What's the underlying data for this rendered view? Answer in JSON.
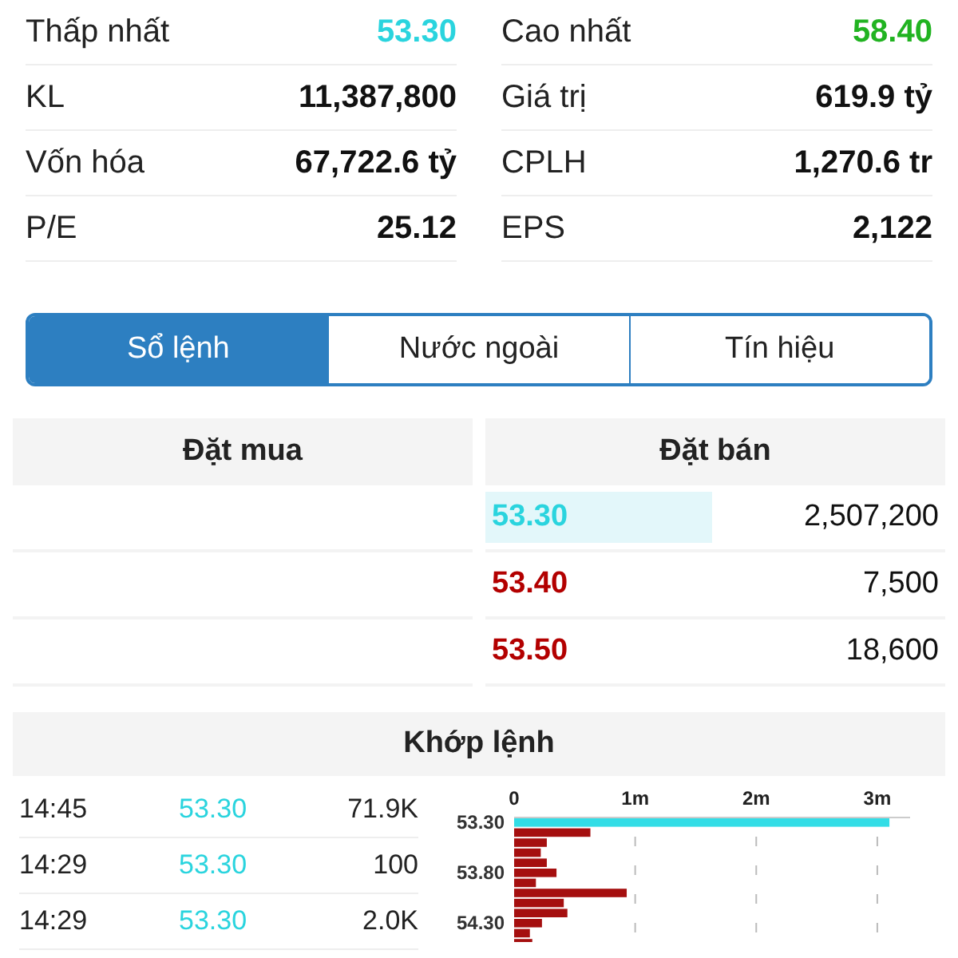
{
  "stats": [
    {
      "label": "Thấp nhất",
      "value": "53.30",
      "color": "#2ad4de"
    },
    {
      "label": "Cao nhất",
      "value": "58.40",
      "color": "#21b321"
    },
    {
      "label": "KL",
      "value": "11,387,800",
      "color": "#111111"
    },
    {
      "label": "Giá trị",
      "value": "619.9 tỷ",
      "color": "#111111"
    },
    {
      "label": "Vốn hóa",
      "value": "67,722.6 tỷ",
      "color": "#111111"
    },
    {
      "label": "CPLH",
      "value": "1,270.6 tr",
      "color": "#111111"
    },
    {
      "label": "P/E",
      "value": "25.12",
      "color": "#111111"
    },
    {
      "label": "EPS",
      "value": "2,122",
      "color": "#111111"
    }
  ],
  "tabs": [
    {
      "label": "Sổ lệnh",
      "selected": true
    },
    {
      "label": "Nước ngoài",
      "selected": false
    },
    {
      "label": "Tín hiệu",
      "selected": false
    }
  ],
  "order_book": {
    "columns": [
      "Đặt mua",
      "Đặt bán"
    ],
    "asks": [
      {
        "price": "53.30",
        "volume": "2,507,200",
        "color": "#2ad4de",
        "selected": true
      },
      {
        "price": "53.40",
        "volume": "7,500",
        "color": "#b30000",
        "selected": false
      },
      {
        "price": "53.50",
        "volume": "18,600",
        "color": "#b30000",
        "selected": false
      }
    ]
  },
  "matched": {
    "title": "Khớp lệnh",
    "trades": [
      {
        "time": "14:45",
        "price": "53.30",
        "volume": "71.9K"
      },
      {
        "time": "14:29",
        "price": "53.30",
        "volume": "100"
      },
      {
        "time": "14:29",
        "price": "53.30",
        "volume": "2.0K"
      }
    ],
    "chart_data": {
      "type": "bar",
      "orientation": "horizontal",
      "grid": true,
      "x": [
        53.3,
        53.4,
        53.5,
        53.6,
        53.7,
        53.8,
        53.9,
        54.0,
        54.1,
        54.2,
        54.3,
        54.4,
        54.5
      ],
      "series": [
        {
          "color": "#33dde6",
          "values": [
            3100000,
            null,
            null,
            null,
            null,
            null,
            null,
            null,
            null,
            null,
            null,
            null,
            null
          ]
        },
        {
          "color": "#a50f0f",
          "values": [
            null,
            630000,
            270000,
            220000,
            270000,
            350000,
            180000,
            930000,
            410000,
            440000,
            230000,
            130000,
            150000
          ]
        }
      ],
      "xlim": [
        0,
        3350000
      ],
      "ylim": [
        54.55,
        53.25
      ],
      "xticks": [
        {
          "value": 0,
          "label": "0"
        },
        {
          "value": 1000000,
          "label": "1m"
        },
        {
          "value": 2000000,
          "label": "2m"
        },
        {
          "value": 3000000,
          "label": "3m"
        }
      ],
      "yticks": [
        {
          "value": 53.3,
          "label": "53.30"
        },
        {
          "value": 53.8,
          "label": "53.80"
        },
        {
          "value": 54.3,
          "label": "54.30"
        }
      ]
    }
  }
}
